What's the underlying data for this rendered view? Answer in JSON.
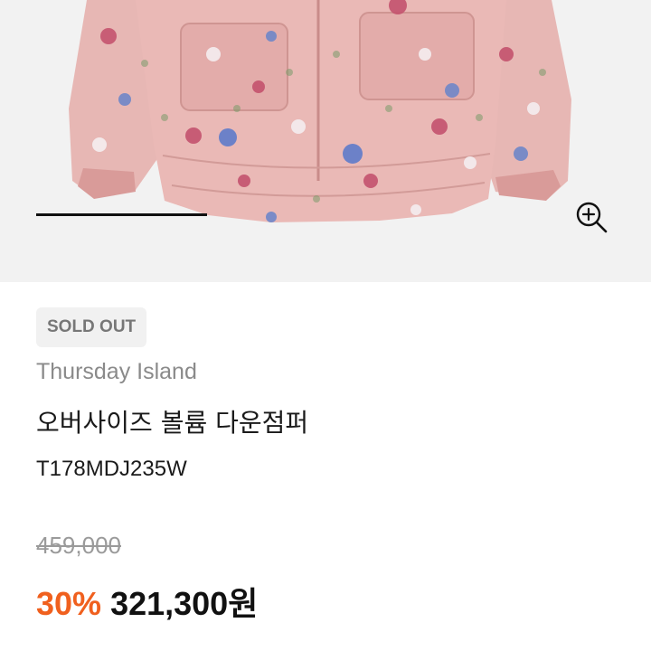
{
  "status_badge": "SOLD OUT",
  "product": {
    "brand": "Thursday Island",
    "name": "오버사이즈 볼륨 다운점퍼",
    "code": "T178MDJ235W"
  },
  "price": {
    "original": "459,000",
    "discount": "30%",
    "sale_amount": "321,300",
    "currency_suffix": "원"
  },
  "gallery": {
    "image_alt": "Pink floral print oversized down jacket",
    "progress_fraction": 0.295,
    "zoom_icon": "zoom-in-icon"
  },
  "colors": {
    "accent_discount": "#f0601e",
    "jacket_base": "#e6b5b3"
  }
}
